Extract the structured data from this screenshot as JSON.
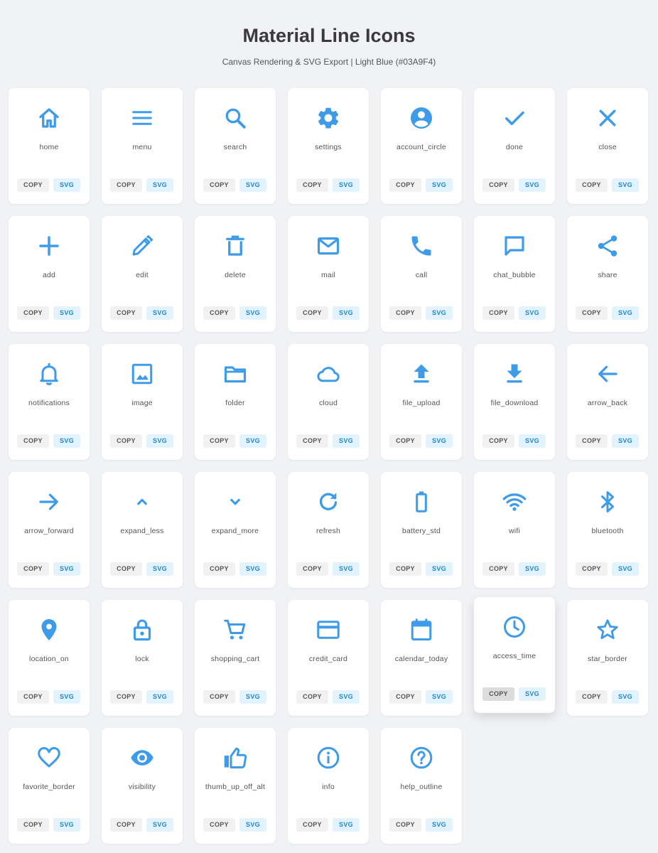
{
  "header": {
    "title": "Material Line Icons",
    "subtitle": "Canvas Rendering & SVG Export | Light Blue (#03A9F4)"
  },
  "accent_color": "#3E9BE8",
  "buttons": {
    "copy_label": "COPY",
    "svg_label": "SVG"
  },
  "icons": [
    {
      "name": "home"
    },
    {
      "name": "menu"
    },
    {
      "name": "search"
    },
    {
      "name": "settings"
    },
    {
      "name": "account_circle"
    },
    {
      "name": "done"
    },
    {
      "name": "close"
    },
    {
      "name": "add"
    },
    {
      "name": "edit"
    },
    {
      "name": "delete"
    },
    {
      "name": "mail"
    },
    {
      "name": "call"
    },
    {
      "name": "chat_bubble"
    },
    {
      "name": "share"
    },
    {
      "name": "notifications"
    },
    {
      "name": "image"
    },
    {
      "name": "folder"
    },
    {
      "name": "cloud"
    },
    {
      "name": "file_upload"
    },
    {
      "name": "file_download"
    },
    {
      "name": "arrow_back"
    },
    {
      "name": "arrow_forward"
    },
    {
      "name": "expand_less"
    },
    {
      "name": "expand_more"
    },
    {
      "name": "refresh"
    },
    {
      "name": "battery_std"
    },
    {
      "name": "wifi"
    },
    {
      "name": "bluetooth"
    },
    {
      "name": "location_on"
    },
    {
      "name": "lock"
    },
    {
      "name": "shopping_cart"
    },
    {
      "name": "credit_card"
    },
    {
      "name": "calendar_today"
    },
    {
      "name": "access_time",
      "hovered": true
    },
    {
      "name": "star_border"
    },
    {
      "name": "favorite_border"
    },
    {
      "name": "visibility"
    },
    {
      "name": "thumb_up_off_alt"
    },
    {
      "name": "info"
    },
    {
      "name": "help_outline"
    }
  ]
}
